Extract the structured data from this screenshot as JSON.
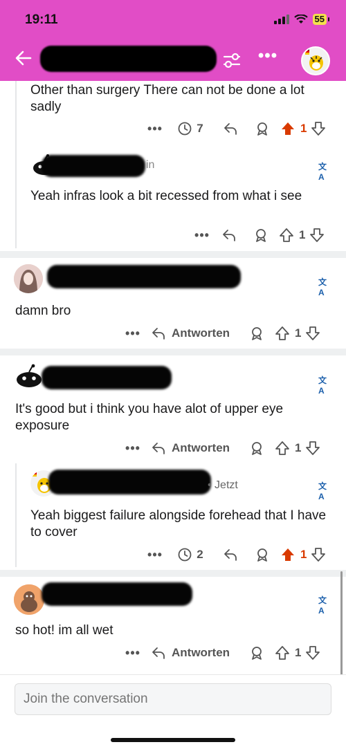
{
  "status": {
    "time": "19:11",
    "battery": "55"
  },
  "comments": {
    "c1": {
      "text": "Other than surgery There can not be done a lot sadly",
      "awards": "7",
      "votes": "1"
    },
    "c2": {
      "author_tail": "in",
      "text": "Yeah infras look a bit recessed from what i see",
      "votes": "1"
    },
    "c3": {
      "text": "damn bro",
      "reply": "Antworten",
      "votes": "1"
    },
    "c4": {
      "text": "It's good but i think you have alot of upper eye exposure",
      "reply": "Antworten",
      "votes": "1"
    },
    "c5": {
      "time": "• Jetzt",
      "text": "Yeah biggest failure alongside forehead that I have to cover",
      "awards": "2",
      "votes": "1"
    },
    "c6": {
      "text": "so hot! im all wet",
      "reply": "Antworten",
      "votes": "1"
    }
  },
  "composer": {
    "placeholder": "Join the conversation"
  },
  "colors": {
    "header": "#e14dc6",
    "upvote_active": "#d93a00",
    "translate": "#1b5fab"
  },
  "icons": [
    "back-arrow-icon",
    "filter-icon",
    "more-icon",
    "translate-icon",
    "reply-icon",
    "award-icon",
    "upvote-icon",
    "downvote-icon",
    "clock-icon"
  ]
}
